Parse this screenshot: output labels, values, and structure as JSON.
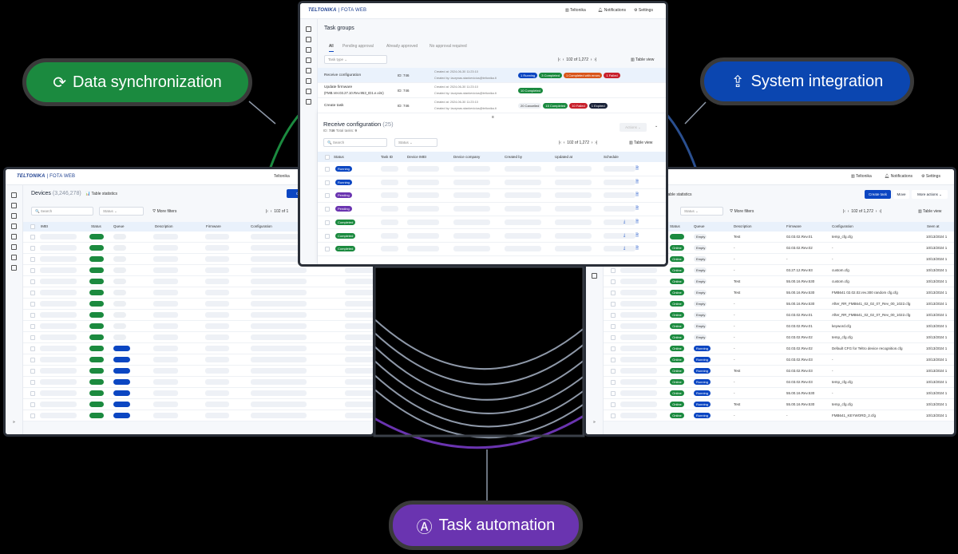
{
  "colors": {
    "green": "#1b8a3f",
    "blue": "#0b46c2",
    "purple": "#6a34b0",
    "background": "#000000"
  },
  "pills": {
    "sync": {
      "label": "Data synchronization",
      "icon": "sync-icon"
    },
    "integration": {
      "label": "System integration",
      "icon": "upload-icon"
    },
    "automation": {
      "label": "Task automation",
      "icon": "automation-icon"
    }
  },
  "app": {
    "logo": "TELTONIKA",
    "product": "FOTA WEB",
    "company": "Teltonika",
    "notifications": "Notifications",
    "settings": "Settings",
    "collapse": "»"
  },
  "task_groups": {
    "title": "Task groups",
    "tabs": [
      "All",
      "Pending approval",
      "Already approved",
      "No approval required"
    ],
    "task_type_placeholder": "Task type",
    "page": "102",
    "page_of": "of 1,272",
    "table_view": "Table view",
    "rows": [
      {
        "name": "Receive configuration",
        "id": "ID: 746",
        "created_at": "Created at: 2024-06-30 11:23:10",
        "created_by": "Created by: laurynas.stankevicius@teltonika.lt",
        "badges": [
          {
            "t": "1 Running",
            "c": "blue"
          },
          {
            "t": "3 Completed",
            "c": "green"
          },
          {
            "t": "1 Completed with errors",
            "c": "orange"
          },
          {
            "t": "1 Failed",
            "c": "red"
          }
        ]
      },
      {
        "name": "Update firmware",
        "name2": "(FMB.Ver.03.27.10.Rev.953_ID1.e.xim)",
        "id": "ID: 746",
        "created_at": "Created at: 2024-06-30 11:23:10",
        "created_by": "Created by: laurynas.stankevicius@teltonika.lt",
        "badges": [
          {
            "t": "10 Completed",
            "c": "green"
          }
        ]
      },
      {
        "name": "Create task",
        "id": "ID: 746",
        "created_at": "Created at: 2024-06-30 11:23:10",
        "created_by": "Created by: laurynas.stankevicius@teltonika.lt",
        "badges": [
          {
            "t": "20 Cancelled",
            "c": "grey"
          },
          {
            "t": "15 Completed",
            "c": "green"
          },
          {
            "t": "10 Failed",
            "c": "red"
          },
          {
            "t": "1 Expired",
            "c": "navy"
          }
        ]
      }
    ]
  },
  "receive_panel": {
    "title": "Receive configuration",
    "count": "(25)",
    "id_label": "ID:",
    "id": "746",
    "total_label": "Total tasks:",
    "total": "9",
    "actions": "Actions",
    "search_placeholder": "Search",
    "status_placeholder": "Status",
    "page": "102",
    "page_of": "of 1,272",
    "table_view": "Table view",
    "columns": [
      "Status",
      "Task ID",
      "Device IMEI",
      "Device company",
      "Created by",
      "Updated at",
      "Schedule"
    ],
    "rows": [
      {
        "status": "Running",
        "c": "blue",
        "dl": false
      },
      {
        "status": "Running",
        "c": "blue",
        "dl": false
      },
      {
        "status": "Pending",
        "c": "purple",
        "dl": false
      },
      {
        "status": "Pending",
        "c": "purple",
        "dl": false
      },
      {
        "status": "Completed",
        "c": "green",
        "dl": true
      },
      {
        "status": "Completed",
        "c": "green",
        "dl": true
      },
      {
        "status": "Completed",
        "c": "green",
        "dl": true
      }
    ]
  },
  "devices_left": {
    "title": "Devices",
    "count": "(3,246,278)",
    "table_statistics": "Table statistics",
    "create": "Create t",
    "search_placeholder": "Search",
    "status_placeholder": "Status",
    "more_filters": "More filters",
    "page": "102",
    "page_of": "of 1",
    "columns": [
      "IMEI",
      "Status",
      "Queue",
      "Description",
      "Firmware",
      "Configuration"
    ],
    "queue": [
      "empty",
      "empty",
      "empty",
      "empty",
      "empty",
      "empty",
      "empty",
      "empty",
      "empty",
      "empty",
      "running",
      "running",
      "running",
      "running",
      "running",
      "running",
      "running"
    ]
  },
  "devices_right": {
    "table_statistics": "Table statistics",
    "create_task": "Create task",
    "move": "Move",
    "more_actions": "More actions",
    "status_placeholder": "Status",
    "more_filters": "More filters",
    "page": "102",
    "page_of": "of 1,272",
    "table_view": "Table view",
    "columns": [
      "Status",
      "Queue",
      "Description",
      "Firmware",
      "Configuration",
      "Seen at"
    ],
    "rows": [
      {
        "status": "",
        "queue": "Empty",
        "desc": "Test",
        "fw": "02.03.02.Rev.01",
        "cfg": "temp_cfg.cfg",
        "seen": "10/13/2024 1"
      },
      {
        "status": "Online",
        "queue": "Empty",
        "desc": "-",
        "fw": "02.03.02.Rev.02",
        "cfg": "-",
        "seen": "10/13/2024 1"
      },
      {
        "status": "Online",
        "queue": "Empty",
        "desc": "-",
        "fw": "-",
        "cfg": "-",
        "seen": "10/13/2024 1"
      },
      {
        "status": "Online",
        "queue": "Empty",
        "desc": "-",
        "fw": "03.27.12.Rev.93",
        "cfg": "custom.cfg",
        "seen": "10/13/2024 1"
      },
      {
        "status": "Online",
        "queue": "Empty",
        "desc": "Test",
        "fw": "55.00.16.Rev.530",
        "cfg": "custom.cfg",
        "seen": "10/13/2024 1"
      },
      {
        "status": "Online",
        "queue": "Empty",
        "desc": "Test",
        "fw": "55.00.16.Rev.530",
        "cfg": "FMB641 02.02.02.rev.300 random cfg.cfg",
        "seen": "10/13/2024 1"
      },
      {
        "status": "Online",
        "queue": "Empty",
        "desc": "-",
        "fw": "55.00.16.Rev.530",
        "cfg": "After_RR_FMB641_02_02_07_Rev_00_1022.cfg",
        "seen": "10/13/2024 1"
      },
      {
        "status": "Online",
        "queue": "Empty",
        "desc": "-",
        "fw": "02.03.02.Rev.01",
        "cfg": "After_RR_FMB641_02_02_07_Rev_00_1022.cfg",
        "seen": "10/13/2024 1"
      },
      {
        "status": "Online",
        "queue": "Empty",
        "desc": "-",
        "fw": "02.03.02.Rev.01",
        "cfg": "keyword.cfg",
        "seen": "10/13/2024 1"
      },
      {
        "status": "Online",
        "queue": "Empty",
        "desc": "-",
        "fw": "02.03.02.Rev.02",
        "cfg": "temp_cfg.cfg",
        "seen": "10/13/2024 1"
      },
      {
        "status": "Online",
        "queue": "Running",
        "desc": "-",
        "fw": "02.03.02.Rev.02",
        "cfg": "Default CFG for Teltro device recognition.cfg",
        "seen": "10/13/2024 1"
      },
      {
        "status": "Online",
        "queue": "Running",
        "desc": "-",
        "fw": "02.03.02.Rev.03",
        "cfg": "-",
        "seen": "10/13/2024 1"
      },
      {
        "status": "Online",
        "queue": "Running",
        "desc": "Test",
        "fw": "02.03.02.Rev.03",
        "cfg": "-",
        "seen": "10/13/2024 1"
      },
      {
        "status": "Online",
        "queue": "Running",
        "desc": "-",
        "fw": "02.03.02.Rev.03",
        "cfg": "temp_cfg.cfg",
        "seen": "10/13/2024 1"
      },
      {
        "status": "Online",
        "queue": "Running",
        "desc": "-",
        "fw": "55.00.16.Rev.530",
        "cfg": "-",
        "seen": "10/13/2024 1"
      },
      {
        "status": "Online",
        "queue": "Running",
        "desc": "Test",
        "fw": "55.00.16.Rev.530",
        "cfg": "temp_cfg.cfg",
        "seen": "10/13/2024 1"
      },
      {
        "status": "Online",
        "queue": "Running",
        "desc": "-",
        "fw": "-",
        "cfg": "FMB641_KEYWORD_2.cfg",
        "seen": "10/13/2024 1"
      }
    ]
  }
}
